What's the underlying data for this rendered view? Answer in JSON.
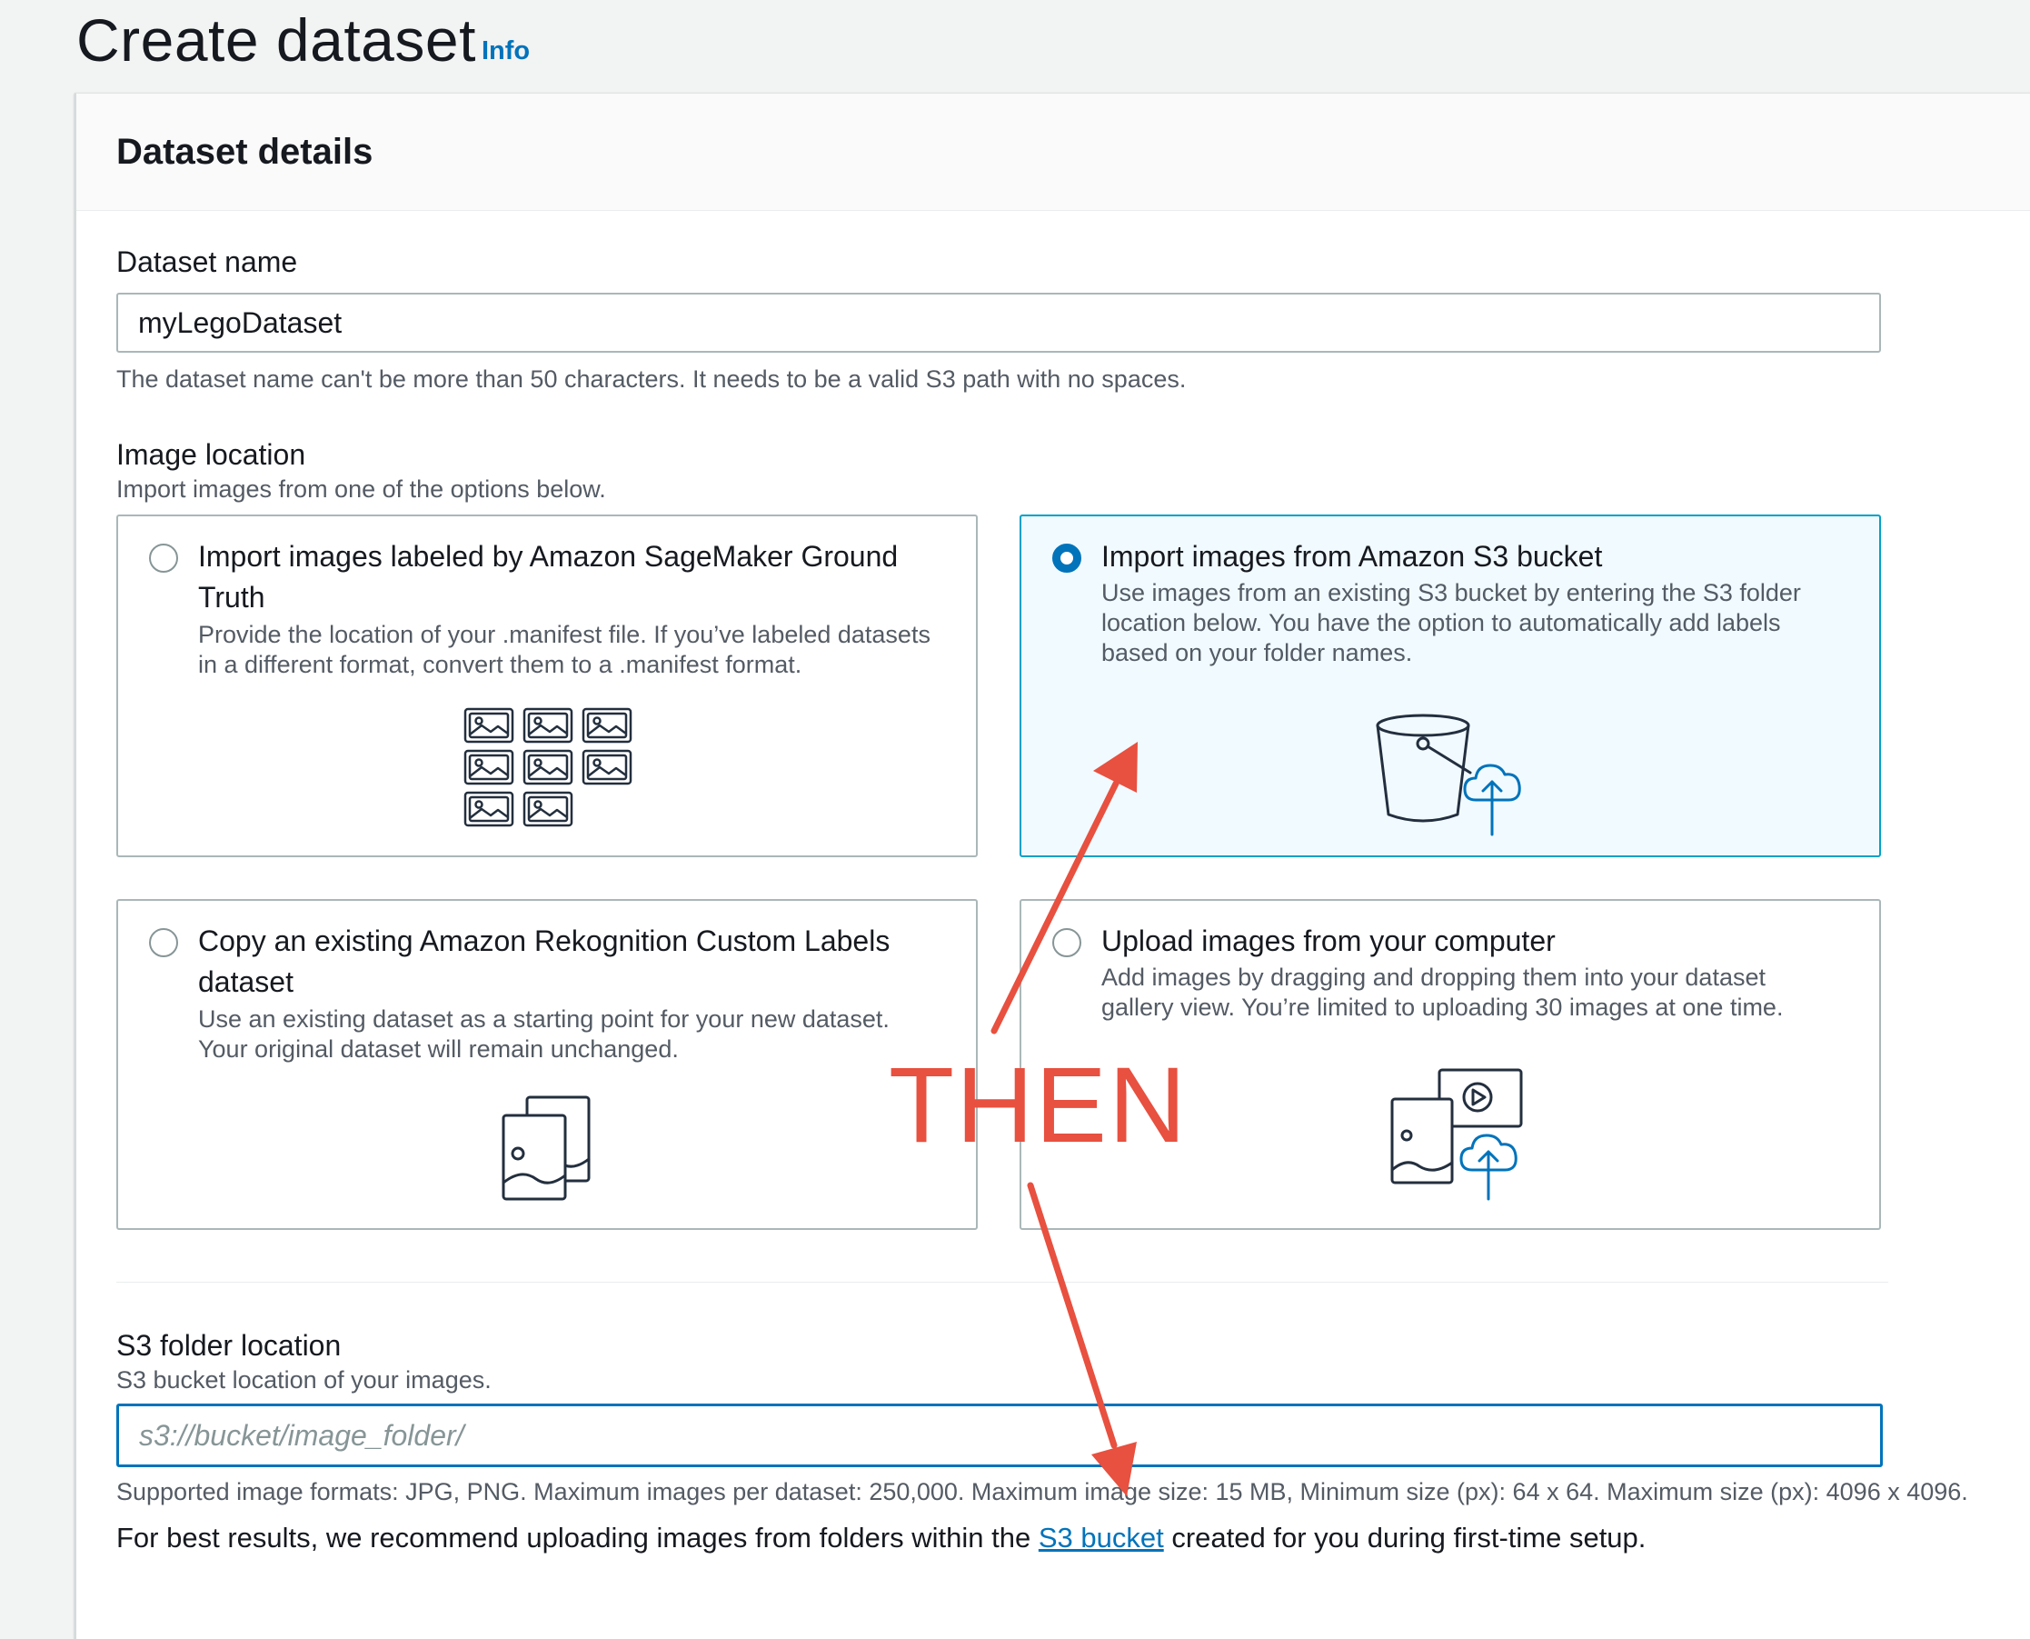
{
  "page": {
    "title": "Create dataset",
    "info_link": "Info"
  },
  "panel": {
    "title": "Dataset details"
  },
  "dataset_name": {
    "label": "Dataset name",
    "value": "myLegoDataset",
    "constraint": "The dataset name can't be more than 50 characters. It needs to be a valid S3 path with no spaces."
  },
  "image_location": {
    "label": "Image location",
    "description": "Import images from one of the options below.",
    "options": [
      {
        "title_line1": "Import images labeled by Amazon SageMaker Ground",
        "title_line2": "Truth",
        "desc_line1": "Provide the location of your .manifest file. If you’ve labeled datasets",
        "desc_line2": "in a different format, convert them to a .manifest format.",
        "selected": false,
        "icon": "image-grid-icon"
      },
      {
        "title_line1": "Import images from Amazon S3 bucket",
        "desc_line1": "Use images from an existing S3 bucket by entering the S3 folder",
        "desc_line2": "location below. You have the option to automatically add labels",
        "desc_line3": "based on your folder names.",
        "selected": true,
        "icon": "s3-bucket-upload-icon"
      },
      {
        "title_line1": "Copy an existing Amazon Rekognition Custom Labels",
        "title_line2": "dataset",
        "desc_line1": "Use an existing dataset as a starting point for your new dataset.",
        "desc_line2": "Your original dataset will remain unchanged.",
        "selected": false,
        "icon": "copy-images-icon"
      },
      {
        "title_line1": "Upload images from your computer",
        "desc_line1": "Add images by dragging and dropping them into your dataset",
        "desc_line2": "gallery view. You’re limited to uploading 30 images at one time.",
        "selected": false,
        "icon": "computer-upload-icon"
      }
    ]
  },
  "s3_folder": {
    "label": "S3 folder location",
    "description": "S3 bucket location of your images.",
    "placeholder": "s3://bucket/image_folder/",
    "formats_hint": "Supported image formats: JPG, PNG. Maximum images per dataset: 250,000. Maximum image size: 15 MB, Minimum size (px): 64 x 64. Maximum size (px): 4096 x 4096.",
    "recommend_prefix": "For best results, we recommend uploading images from folders within the ",
    "recommend_link": "S3 bucket",
    "recommend_suffix": " created for you during first-time setup."
  },
  "annotation": {
    "text": "THEN",
    "color": "#e8503f"
  },
  "colors": {
    "accent": "#0073bb",
    "selected_tile_bg": "#f1faff",
    "selected_tile_border": "#00a1c9"
  }
}
